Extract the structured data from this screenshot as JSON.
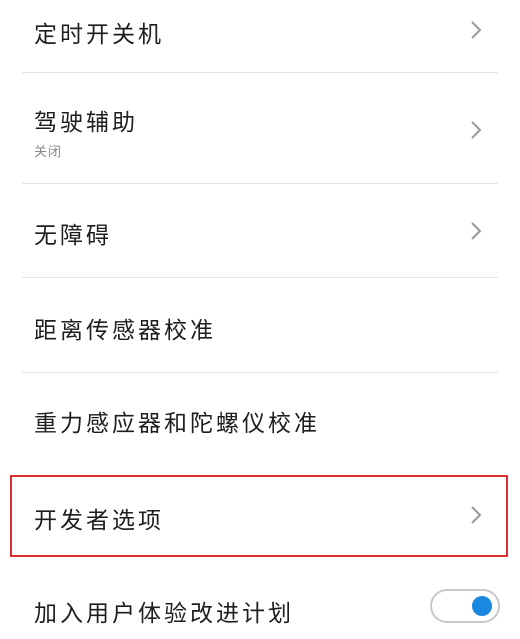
{
  "settings": {
    "items": [
      {
        "label": "定时开关机"
      },
      {
        "label": "驾驶辅助",
        "sublabel": "关闭"
      },
      {
        "label": "无障碍"
      },
      {
        "label": "距离传感器校准"
      },
      {
        "label": "重力感应器和陀螺仪校准"
      },
      {
        "label": "开发者选项"
      },
      {
        "label": "加入用户体验改进计划",
        "toggle_on": true
      }
    ]
  },
  "colors": {
    "highlight_border": "#d9302f",
    "toggle_knob": "#1a88e0",
    "divider": "#e3e3e3"
  },
  "icons": {
    "chevron": "chevron-right-icon"
  }
}
